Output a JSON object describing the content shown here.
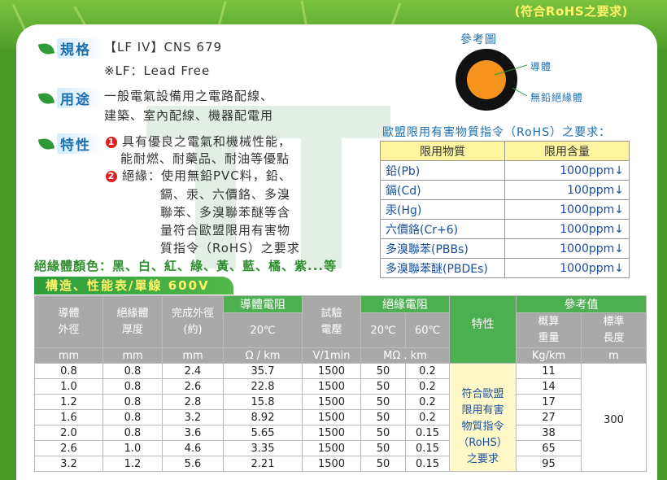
{
  "header": {
    "rohs_note": "(符合RoHS之要求)"
  },
  "spec": {
    "tag": "規格",
    "line1": "【LF IV】CNS 679",
    "line2": "※LF：Lead Free"
  },
  "usage": {
    "tag": "用途",
    "line1": "一般電氣設備用之電路配線、",
    "line2": "建築、室內配線、機器配電用"
  },
  "features": {
    "tag": "特性",
    "item1_num": "1",
    "item1_line1": "具有優良之電氣和機械性能，",
    "item1_line2": "能耐燃、耐藥品、耐油等優點",
    "item2_num": "2",
    "item2_line1": "絕緣：使用無鉛PVC料，鉛、",
    "item2_line2": "鎘、汞、六價鉻、多溴",
    "item2_line3": "聯苯、多溴聯苯醚等含",
    "item2_line4": "量符合歐盟限用有害物",
    "item2_line5": "質指令（RoHS）之要求"
  },
  "colors_line": "絕緣體顏色：黑、白、紅、綠、黃、藍、橘、紫...等",
  "table_title": "構造、性能表/單線 600V",
  "reference": {
    "title": "參考圖",
    "conductor": "導體",
    "insulation": "無鉛絕緣體",
    "conductor_color": "#f7941d",
    "insulation_color": "#111111"
  },
  "rohs": {
    "title": "歐盟限用有害物質指令（RoHS）之要求：",
    "col1": "限用物質",
    "col2": "限用含量",
    "rows": [
      {
        "substance": "鉛(Pb)",
        "limit": "1000ppm"
      },
      {
        "substance": "鎘(Cd)",
        "limit": "100ppm"
      },
      {
        "substance": "汞(Hg)",
        "limit": "1000ppm"
      },
      {
        "substance": "六價鉻(Cr+6)",
        "limit": "1000ppm"
      },
      {
        "substance": "多溴聯苯(PBBs)",
        "limit": "1000ppm"
      },
      {
        "substance": "多溴聯苯醚(PBDEs)",
        "limit": "1000ppm"
      }
    ],
    "arrow": "↓"
  },
  "spec_table": {
    "h_cond_res": "導體電阻",
    "h_test": "試驗",
    "h_test2": "電壓",
    "h_ins_res": "絕緣電阻",
    "h_feature": "特性",
    "h_ref": "參考值",
    "h_cond_dia1": "導體",
    "h_cond_dia2": "外徑",
    "h_ins_thk1": "絕緣體",
    "h_ins_thk2": "厚度",
    "h_od1": "完成外徑",
    "h_od2": "(約)",
    "h_20c": "20℃",
    "h_ins20": "20℃",
    "h_ins60": "60℃",
    "h_weight1": "概算",
    "h_weight2": "重量",
    "h_len1": "標準",
    "h_len2": "長度",
    "u_mm1": "mm",
    "u_mm2": "mm",
    "u_mm3": "mm",
    "u_ohm": "Ω / km",
    "u_v": "V/1min",
    "u_mohm": "MΩ . km",
    "u_kg": "Kg/km",
    "u_m": "m",
    "rows": [
      [
        "0.8",
        "0.8",
        "2.4",
        "35.7",
        "1500",
        "50",
        "0.2",
        "11"
      ],
      [
        "1.0",
        "0.8",
        "2.6",
        "22.8",
        "1500",
        "50",
        "0.2",
        "14"
      ],
      [
        "1.2",
        "0.8",
        "2.8",
        "15.8",
        "1500",
        "50",
        "0.2",
        "17"
      ],
      [
        "1.6",
        "0.8",
        "3.2",
        "8.92",
        "1500",
        "50",
        "0.2",
        "27"
      ],
      [
        "2.0",
        "0.8",
        "3.6",
        "5.65",
        "1500",
        "50",
        "0.15",
        "38"
      ],
      [
        "2.6",
        "1.0",
        "4.6",
        "3.35",
        "1500",
        "50",
        "0.15",
        "65"
      ],
      [
        "3.2",
        "1.2",
        "5.6",
        "2.21",
        "1500",
        "50",
        "0.15",
        "95"
      ]
    ],
    "feature_text": [
      "符合歐盟",
      "限用有害",
      "物質指令",
      "（RoHS）",
      "之要求"
    ],
    "std_length": "300"
  }
}
